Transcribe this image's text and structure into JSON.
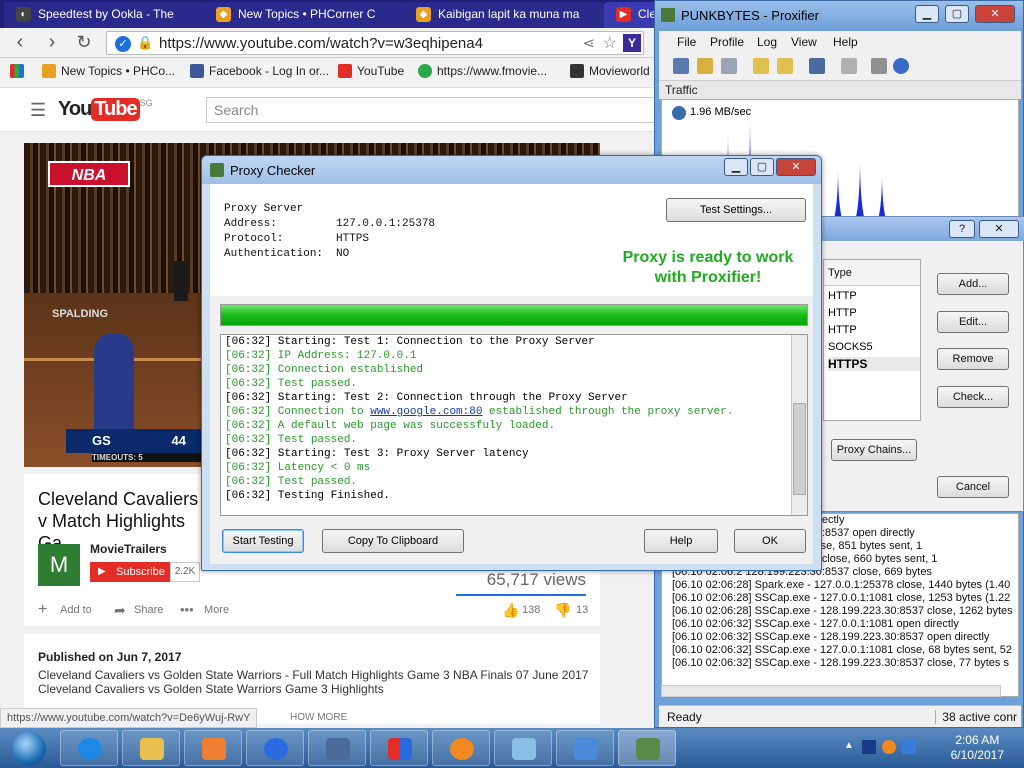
{
  "browser": {
    "tabs": [
      {
        "label": "Speedtest by Ookla - The",
        "color": "#444"
      },
      {
        "label": "New Topics • PHCorner C",
        "color": "#e8a020"
      },
      {
        "label": "Kaibigan lapit ka muna ma",
        "color": "#e8a020"
      },
      {
        "label": "Clev",
        "color": "#e52d27"
      }
    ],
    "url": "https://www.youtube.com/watch?v=w3eqhipena4",
    "bookmarks": [
      {
        "label": "New Topics • PHCo...",
        "color": "#e8a020"
      },
      {
        "label": "Facebook - Log In or...",
        "color": "#3b5998"
      },
      {
        "label": "YouTube",
        "color": "#e52d27"
      },
      {
        "label": "https://www.fmovie...",
        "color": "#2aa84a"
      },
      {
        "label": "Movieworld",
        "color": "#333"
      }
    ]
  },
  "youtube": {
    "logo_you": "You",
    "logo_tube": "Tube",
    "logo_region": "SG",
    "search_placeholder": "Search",
    "video": {
      "nba_logo": "NBA",
      "sponsor": "SPALDING",
      "score_team": "GS",
      "score": "44",
      "timeouts": "TIMEOUTS: 5"
    },
    "title": "Cleveland Cavaliers v Match Highlights Ga",
    "channel": "MovieTrailers",
    "channel_initial": "M",
    "subscribe": "Subscribe",
    "sub_count": "2.2K",
    "views": "65,717 views",
    "actions": {
      "add": "Add to",
      "share": "Share",
      "more": "More",
      "likes": "138",
      "dislikes": "13"
    },
    "published": "Published on Jun 7, 2017",
    "desc_lines": [
      "Cleveland Cavaliers vs Golden State Warriors - Full Match Highlights Game 3 NBA Finals 07 June 2017",
      "Cleveland Cavaliers vs Golden State Warriors Game 3 Highlights"
    ],
    "status_url": "https://www.youtube.com/watch?v=De6yWuj-RwY",
    "show_more": "HOW MORE"
  },
  "proxifier": {
    "title": "PUNKBYTES - Proxifier",
    "menu": [
      "File",
      "Profile",
      "Log",
      "View",
      "Help"
    ],
    "traffic_label": "Traffic",
    "rate": "1.96 MB/sec",
    "graph_peaks": [
      0.14,
      0.86,
      0.98,
      0.58,
      0.36,
      0.66,
      0.54,
      0.62,
      0.5
    ],
    "log": [
      "[06.10 02:06:2                    1:1081 open directly",
      "[06.10 02:06:2          128.199.223.30:8537 open directly",
      "[06.10 02:06:2           0.0.1:25378 close, 851 bytes sent, 1",
      "[06.10 02:06:2           127.0.0.1:1081 close, 660 bytes sent, 1",
      "[06.10 02:06:2           128.199.223.30:8537 close, 669 bytes",
      "[06.10 02:06:28] Spark.exe - 127.0.0.1:25378 close, 1440 bytes (1.40",
      "[06.10 02:06:28] SSCap.exe - 127.0.0.1:1081 close, 1253 bytes (1.22",
      "[06.10 02:06:28] SSCap.exe - 128.199.223.30:8537 close, 1262 bytes",
      "[06.10 02:06:32] SSCap.exe - 127.0.0.1:1081 open directly",
      "[06.10 02:06:32] SSCap.exe - 128.199.223.30:8537 open directly",
      "[06.10 02:06:32] SSCap.exe - 127.0.0.1:1081 close, 68 bytes sent, 52",
      "[06.10 02:06:32] SSCap.exe - 128.199.223.30:8537 close, 77 bytes s"
    ],
    "status_ready": "Ready",
    "status_conns": "38 active conr"
  },
  "servers_dialog": {
    "help": "?",
    "close": "✕",
    "list_header": "Type",
    "types": [
      "HTTP",
      "HTTP",
      "HTTP",
      "SOCKS5",
      "HTTPS"
    ],
    "buttons": {
      "add": "Add...",
      "edit": "Edit...",
      "remove": "Remove",
      "check": "Check...",
      "chains": "Proxy Chains...",
      "cancel": "Cancel"
    }
  },
  "checker": {
    "title": "Proxy Checker",
    "info": [
      {
        "k": "Proxy Server",
        "v": ""
      },
      {
        "k": "Address:",
        "v": "127.0.0.1:25378"
      },
      {
        "k": "Protocol:",
        "v": "HTTPS"
      },
      {
        "k": "Authentication:",
        "v": "NO"
      }
    ],
    "test_settings": "Test Settings...",
    "ready_line1": "Proxy is ready to work",
    "ready_line2": "with Proxifier!",
    "progress": 1.0,
    "log": [
      {
        "t": "[06:32] Starting: Test 1: Connection to the Proxy Server",
        "c": "k"
      },
      {
        "t": "[06:32] IP Address: 127.0.0.1",
        "c": "g"
      },
      {
        "t": "[06:32] Connection established",
        "c": "g"
      },
      {
        "t": "[06:32] Test passed.",
        "c": "g"
      },
      {
        "t": "[06:32] Starting: Test 2: Connection through the Proxy Server",
        "c": "k"
      },
      {
        "t": "[06:32] Connection to ",
        "c": "g",
        "link": "www.google.com:80",
        "after": " established through the proxy server."
      },
      {
        "t": "[06:32] A default web page was successfuly loaded.",
        "c": "g"
      },
      {
        "t": "[06:32] Test passed.",
        "c": "g"
      },
      {
        "t": "[06:32] Starting: Test 3: Proxy Server latency",
        "c": "k"
      },
      {
        "t": "[06:32] Latency < 0 ms",
        "c": "g"
      },
      {
        "t": "[06:32] Test passed.",
        "c": "g"
      },
      {
        "t": "[06:32] Testing Finished.",
        "c": "k"
      }
    ],
    "buttons": {
      "start": "Start Testing",
      "copy": "Copy To Clipboard",
      "help": "Help",
      "ok": "OK"
    }
  },
  "taskbar": {
    "time": "2:06 AM",
    "date": "6/10/2017",
    "apps": [
      "ie",
      "explorer",
      "media",
      "app-blue",
      "settings",
      "app-grid",
      "arrow-app",
      "notepad",
      "network-app",
      "proxy-app"
    ]
  }
}
